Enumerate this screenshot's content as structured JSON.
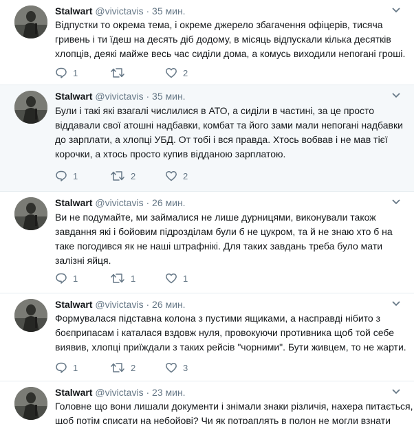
{
  "tweets": [
    {
      "name": "Stalwart",
      "handle": "@vivictavis",
      "dot": "·",
      "time": "35 мин.",
      "lines": [
        "Відпустки то окрема тема, і окреме джерело збагачення офіцерів, тисяча",
        "гривень і ти їдеш на десять діб додому, в місяць відпускали кілька десятків",
        "хлопців, деякі майже весь час сиділи дома, а комусь виходили непогані гроші."
      ],
      "replies": "1",
      "retweets": "",
      "likes": "2",
      "icons": [
        "chevron-down-icon",
        "reply-icon",
        "retweet-icon",
        "heart-icon"
      ]
    },
    {
      "name": "Stalwart",
      "handle": "@vivictavis",
      "dot": "·",
      "time": "35 мин.",
      "lines": [
        "Були і такі які взагалі числилися в АТО, а сиділи в частині, за це просто",
        "віддавали свої атошні надбавки, комбат та його зами мали непогані надбавки",
        "до зарплати, а хлопці УБД. От тобі і вся правда. Хтось вобвав і не мав тієї",
        "корочки, а хтось просто купив відданою зарплатою."
      ],
      "replies": "1",
      "retweets": "2",
      "likes": "2",
      "icons": [
        "chevron-down-icon",
        "reply-icon",
        "retweet-icon",
        "heart-icon"
      ]
    },
    {
      "name": "Stalwart",
      "handle": "@vivictavis",
      "dot": "·",
      "time": "26 мин.",
      "lines": [
        "Ви не подумайте, ми займалися не лише дурницями, виконували також",
        "завдання які і бойовим підрозділам були б не цукром, та й не знаю хто б на",
        "таке погодився як не наші штрафнікі. Для таких завдань треба було мати",
        "залізні яйця."
      ],
      "replies": "1",
      "retweets": "1",
      "likes": "1",
      "icons": [
        "chevron-down-icon",
        "reply-icon",
        "retweet-icon",
        "heart-icon"
      ]
    },
    {
      "name": "Stalwart",
      "handle": "@vivictavis",
      "dot": "·",
      "time": "26 мин.",
      "lines": [
        "Формувалася підставна колона з пустими ящиками, а насправді нібито з",
        "боєприпасам  і каталася вздовж нуля, провокуючи противника щоб той себе",
        "виявив, хлопці приїждали з таких рейсів \"чорними\". Бути живцем, то не жарти."
      ],
      "replies": "1",
      "retweets": "2",
      "likes": "3",
      "icons": [
        "chevron-down-icon",
        "reply-icon",
        "retweet-icon",
        "heart-icon"
      ]
    },
    {
      "name": "Stalwart",
      "handle": "@vivictavis",
      "dot": "·",
      "time": "23 мин.",
      "lines": [
        "Головне що вони лишали документи і знімали знаки різличія, нахера питається,",
        "щоб потім списати на небойові? Чи як потраплять в полон не  могли взнати"
      ],
      "replies": "",
      "retweets": "",
      "likes": "",
      "icons": [
        "chevron-down-icon"
      ]
    }
  ],
  "colors": {
    "name": "#14171a",
    "meta": "#657786",
    "border": "#e6ecf0",
    "highlight": "#f5f8fa"
  }
}
